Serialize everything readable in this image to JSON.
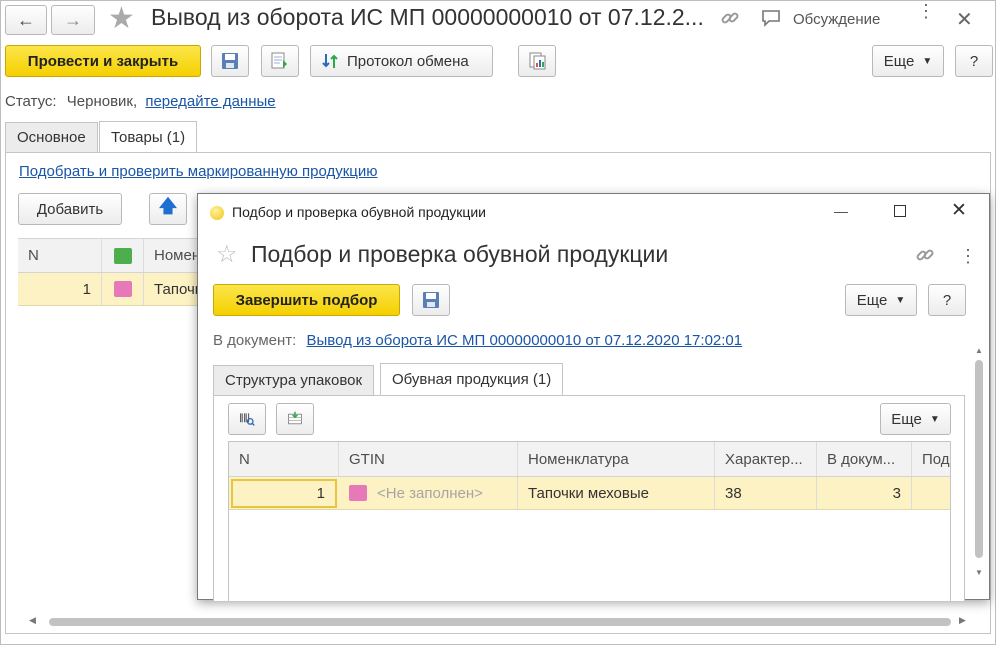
{
  "main": {
    "title": "Вывод из оборота ИС МП 00000000010 от 07.12.2...",
    "discussion": "Обсуждение",
    "toolbar": {
      "post_close": "Провести и закрыть",
      "protocol": "Протокол обмена",
      "more": "Еще",
      "help": "?"
    },
    "status_label": "Статус:",
    "status_value": "Черновик,",
    "status_link": "передайте данные",
    "tabs": [
      "Основное",
      "Товары (1)"
    ],
    "select_link": "Подобрать и проверить маркированную продукцию",
    "add_button": "Добавить",
    "grid": {
      "headers": [
        "N",
        "Номен"
      ],
      "row": {
        "n": "1",
        "name": "Тапочк"
      }
    }
  },
  "dialog": {
    "window_title": "Подбор и проверка обувной продукции",
    "title": "Подбор и проверка обувной продукции",
    "finish": "Завершить подбор",
    "more": "Еще",
    "help": "?",
    "doc_label": "В документ:",
    "doc_link": "Вывод из оборота ИС МП 00000000010 от 07.12.2020 17:02:01",
    "tabs": [
      "Структура упаковок",
      "Обувная продукция (1)"
    ],
    "grid_more": "Еще",
    "grid": {
      "headers": [
        "N",
        "GTIN",
        "Номенклатура",
        "Характер...",
        "В докум...",
        "Под"
      ],
      "rows": [
        {
          "n": "1",
          "gtin": "<Не заполнен>",
          "name": "Тапочки меховые",
          "char": "38",
          "qty": "3"
        }
      ]
    }
  },
  "colors": {
    "accent_yellow": "#f5d000",
    "link": "#1a56a8",
    "selected_row": "#fdf2c4",
    "marker_pink": "#e879b9",
    "marker_green": "#4cae4c"
  }
}
